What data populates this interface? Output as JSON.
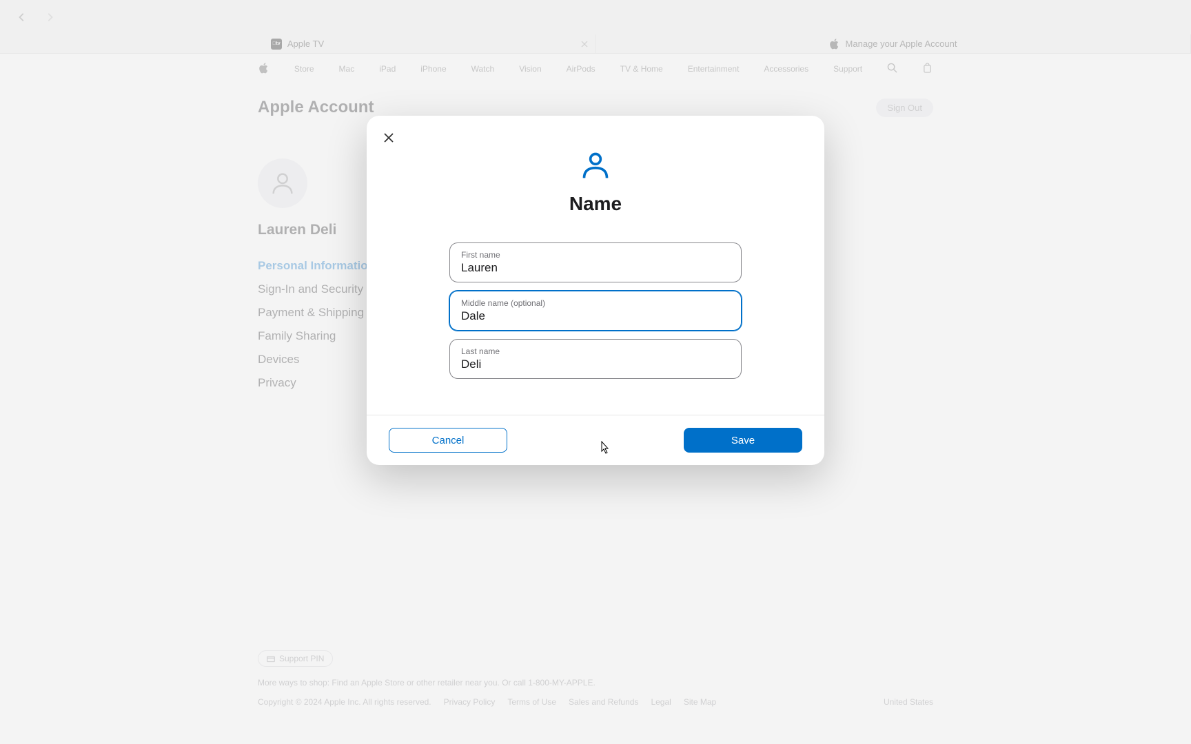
{
  "browser": {
    "tabs": [
      {
        "label": "Apple TV",
        "icon": "appletv"
      },
      {
        "label": "Manage your Apple Account",
        "icon": "apple"
      }
    ]
  },
  "globalNav": [
    "Store",
    "Mac",
    "iPad",
    "iPhone",
    "Watch",
    "Vision",
    "AirPods",
    "TV & Home",
    "Entertainment",
    "Accessories",
    "Support"
  ],
  "header": {
    "title": "Apple Account",
    "signout": "Sign Out"
  },
  "sidebar": {
    "name": "Lauren Deli",
    "items": [
      "Personal Information",
      "Sign-In and Security",
      "Payment & Shipping",
      "Family Sharing",
      "Devices",
      "Privacy"
    ]
  },
  "modal": {
    "title": "Name",
    "fields": {
      "first": {
        "label": "First name",
        "value": "Lauren"
      },
      "middle": {
        "label": "Middle name (optional)",
        "value": "Dale"
      },
      "last": {
        "label": "Last name",
        "value": "Deli"
      }
    },
    "cancel": "Cancel",
    "save": "Save"
  },
  "footer": {
    "support_pin": "Support PIN",
    "shop_text": "More ways to shop: Find an Apple Store or other retailer near you. Or call 1-800-MY-APPLE.",
    "copyright": "Copyright © 2024 Apple Inc. All rights reserved.",
    "links": [
      "Privacy Policy",
      "Terms of Use",
      "Sales and Refunds",
      "Legal",
      "Site Map"
    ],
    "country": "United States"
  }
}
